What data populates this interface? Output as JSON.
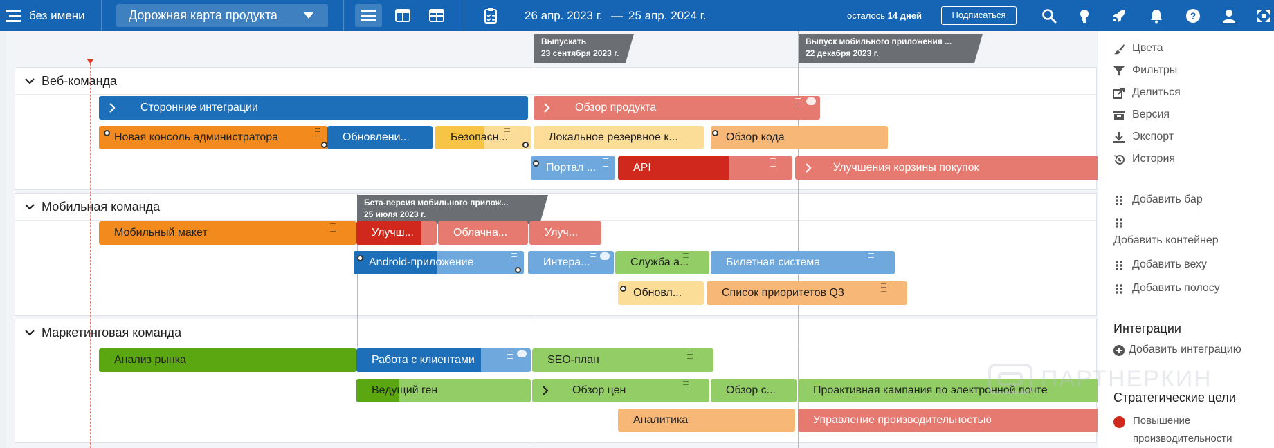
{
  "topbar": {
    "workspace": "без имени",
    "roadmap_name": "Дорожная карта продукта",
    "date_start": "26 апр. 2023 г.",
    "date_sep": "—",
    "date_end": "25 апр. 2024 г.",
    "trial_prefix": "осталось",
    "trial_days": "14 дней",
    "subscribe_label": "Подписаться",
    "bg_color": "#1565b4"
  },
  "milestones": [
    {
      "title": "Выпускать",
      "date": "23 сентября 2023 г."
    },
    {
      "title": "Выпуск мобильного приложения ...",
      "date": "22 декабря 2023 г."
    },
    {
      "title": "Бета-версия мобильного прилож...",
      "date": "25 июля 2023 г."
    }
  ],
  "containers": [
    {
      "title": "Веб-команда",
      "bars": [
        {
          "label": "Сторонние интеграции"
        },
        {
          "label": "Обзор продукта"
        },
        {
          "label": "Новая консоль администратора"
        },
        {
          "label": "Обновлени..."
        },
        {
          "label": "Безопасн..."
        },
        {
          "label": "Локальное резервное к..."
        },
        {
          "label": "Обзор кода"
        },
        {
          "label": "Портал ..."
        },
        {
          "label": "API"
        },
        {
          "label": "Улучшения корзины покупок"
        }
      ]
    },
    {
      "title": "Мобильная команда",
      "bars": [
        {
          "label": "Мобильный макет"
        },
        {
          "label": "Улучш..."
        },
        {
          "label": "Облачна..."
        },
        {
          "label": "Улуч..."
        },
        {
          "label": "Android-приложение"
        },
        {
          "label": "Интера..."
        },
        {
          "label": "Служба а..."
        },
        {
          "label": "Билетная система"
        },
        {
          "label": "Обновл..."
        },
        {
          "label": "Список приоритетов Q3"
        }
      ]
    },
    {
      "title": "Маркетинговая команда",
      "bars": [
        {
          "label": "Анализ рынка"
        },
        {
          "label": "Работа с клиентами"
        },
        {
          "label": "SEO-план"
        },
        {
          "label": "Ведущий ген"
        },
        {
          "label": "Обзор цен"
        },
        {
          "label": "Обзор с..."
        },
        {
          "label": "Проактивная кампания по электронной почте"
        },
        {
          "label": "Аналитика"
        },
        {
          "label": "Управление производительностью"
        }
      ]
    }
  ],
  "panel": {
    "items": [
      {
        "label": "Цвета",
        "icon": "brush-icon"
      },
      {
        "label": "Фильтры",
        "icon": "filter-icon"
      },
      {
        "label": "Делиться",
        "icon": "share-icon"
      },
      {
        "label": "Версия",
        "icon": "archive-icon"
      },
      {
        "label": "Экспорт",
        "icon": "download-icon"
      },
      {
        "label": "История",
        "icon": "history-icon"
      }
    ],
    "add_items": [
      {
        "label": "Добавить бар"
      },
      {
        "label": "Добавить контейнер"
      },
      {
        "label": "Добавить веху"
      },
      {
        "label": "Добавить полосу"
      }
    ],
    "integrations_title": "Интеграции",
    "add_integration": "Добавить интеграцию",
    "goals_title": "Стратегические цели",
    "goal_line1": "Повышение",
    "goal_line2": "производительности",
    "goal_color": "#d0281d"
  },
  "watermark": "ПАРТНЕРКИН",
  "colors": {
    "blue": "#1c6fb8",
    "light_blue": "#6fa8dc",
    "orange": "#f28a1e",
    "light_orange": "#f7b877",
    "yellow": "#f8c446",
    "light_yellow": "#fcdd97",
    "red": "#d0281d",
    "salmon": "#e67a70",
    "green": "#5aa712",
    "light_green": "#93cd66"
  }
}
